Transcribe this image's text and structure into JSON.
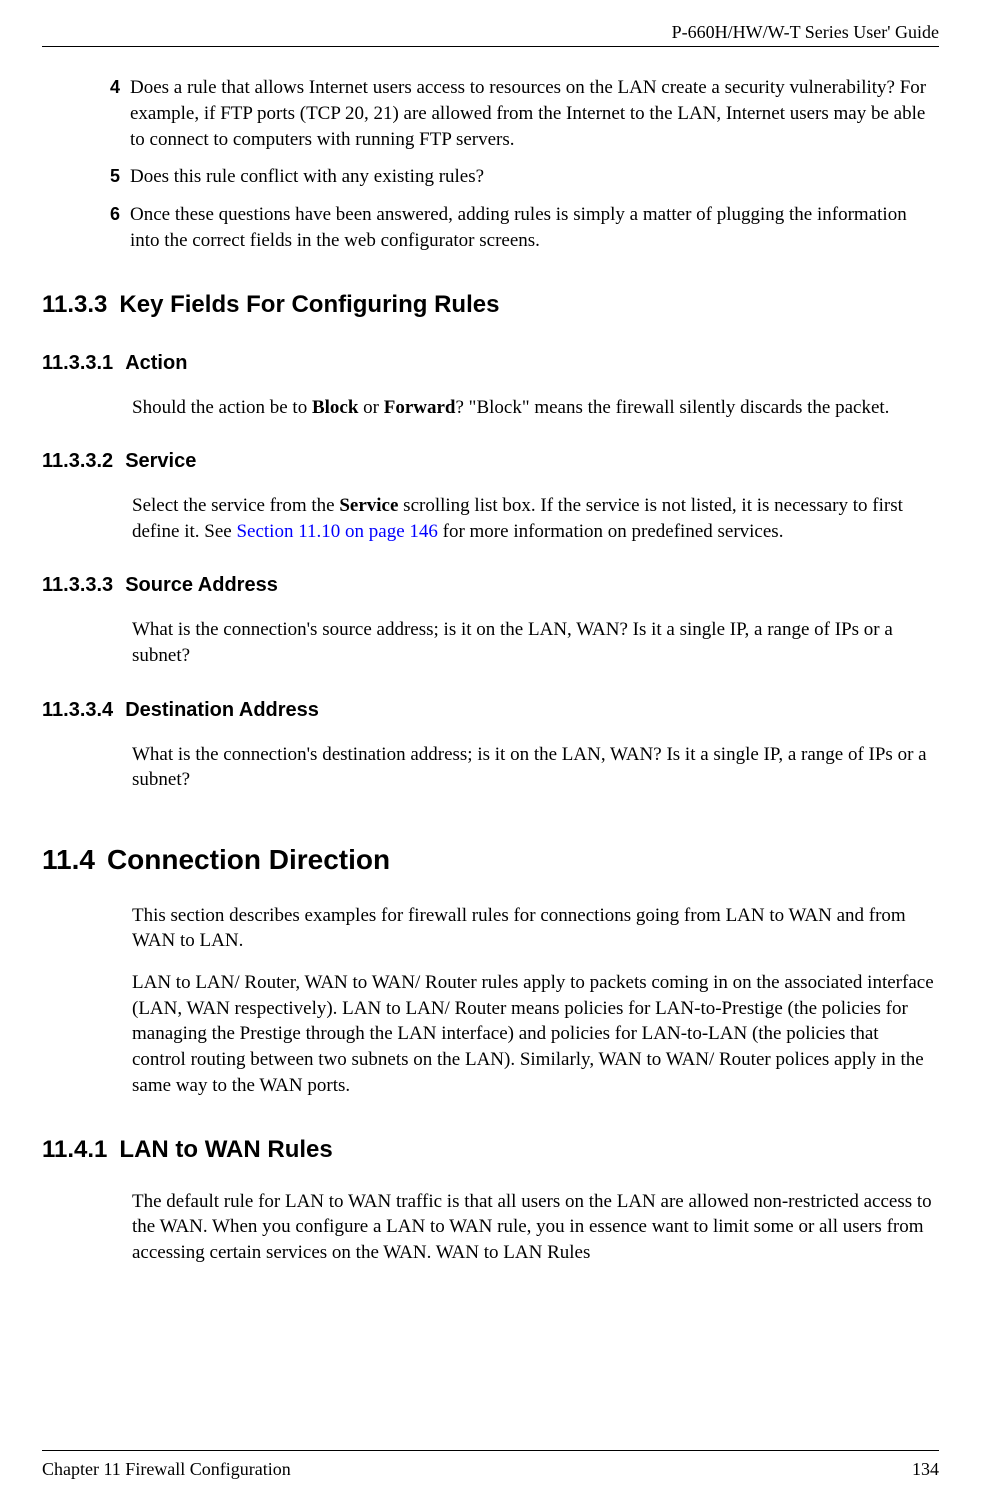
{
  "header": {
    "guide_title": "P-660H/HW/W-T Series User' Guide"
  },
  "list_items": {
    "n4": "4",
    "t4": "Does a rule that allows Internet users access to resources on the LAN create a security vulnerability? For example, if FTP ports (TCP 20, 21) are allowed from the Internet to the LAN, Internet users may be able to connect to computers with running FTP servers.",
    "n5": "5",
    "t5": "Does this rule conflict with any existing rules?",
    "n6": "6",
    "t6": "Once these questions have been answered, adding rules is simply a matter of plugging the information into the correct fields in the web configurator screens."
  },
  "sections": {
    "s1133_num": "11.3.3",
    "s1133_title": "Key Fields For Configuring Rules",
    "s11331_num": "11.3.3.1",
    "s11331_title": "Action",
    "s11331_text_pre": "Should the action be to ",
    "s11331_bold1": "Block",
    "s11331_mid": " or ",
    "s11331_bold2": "Forward",
    "s11331_text_post": "? \"Block\" means the firewall silently discards the packet.",
    "s11332_num": "11.3.3.2",
    "s11332_title": "Service",
    "s11332_text_pre": "Select the service from the ",
    "s11332_bold": "Service",
    "s11332_text_mid": " scrolling list box. If the service is not listed, it is necessary to first define it. See ",
    "s11332_link": "Section 11.10 on page 146",
    "s11332_text_post": " for more information on predefined services.",
    "s11333_num": "11.3.3.3",
    "s11333_title": "Source Address",
    "s11333_text": "What is the connection's source address; is it on the LAN, WAN? Is it a single IP, a range of IPs or a subnet?",
    "s11334_num": "11.3.3.4",
    "s11334_title": "Destination Address",
    "s11334_text": "What is the connection's destination address; is it on the LAN, WAN? Is it a single IP, a range of IPs or a subnet?",
    "s114_num": "11.4",
    "s114_title": "Connection Direction",
    "s114_p1": "This section describes examples for firewall rules for connections going from LAN to WAN and from WAN to LAN.",
    "s114_p2": "LAN to LAN/ Router, WAN to WAN/ Router rules apply to packets coming in on the associated interface (LAN, WAN respectively). LAN to LAN/ Router means policies for LAN-to-Prestige (the policies for managing the Prestige through the LAN interface) and policies for LAN-to-LAN (the policies that control routing between two subnets on the LAN). Similarly, WAN to WAN/ Router polices apply in the same way to the WAN ports.",
    "s1141_num": "11.4.1",
    "s1141_title": "LAN to WAN Rules",
    "s1141_text": "The default rule for LAN to WAN traffic is that all users on the LAN are allowed non-restricted access to the WAN. When you configure a LAN to WAN rule, you in essence want to limit some or all users from accessing certain services on the WAN. WAN to LAN Rules"
  },
  "footer": {
    "chapter": "Chapter 11 Firewall Configuration",
    "page": "134"
  }
}
